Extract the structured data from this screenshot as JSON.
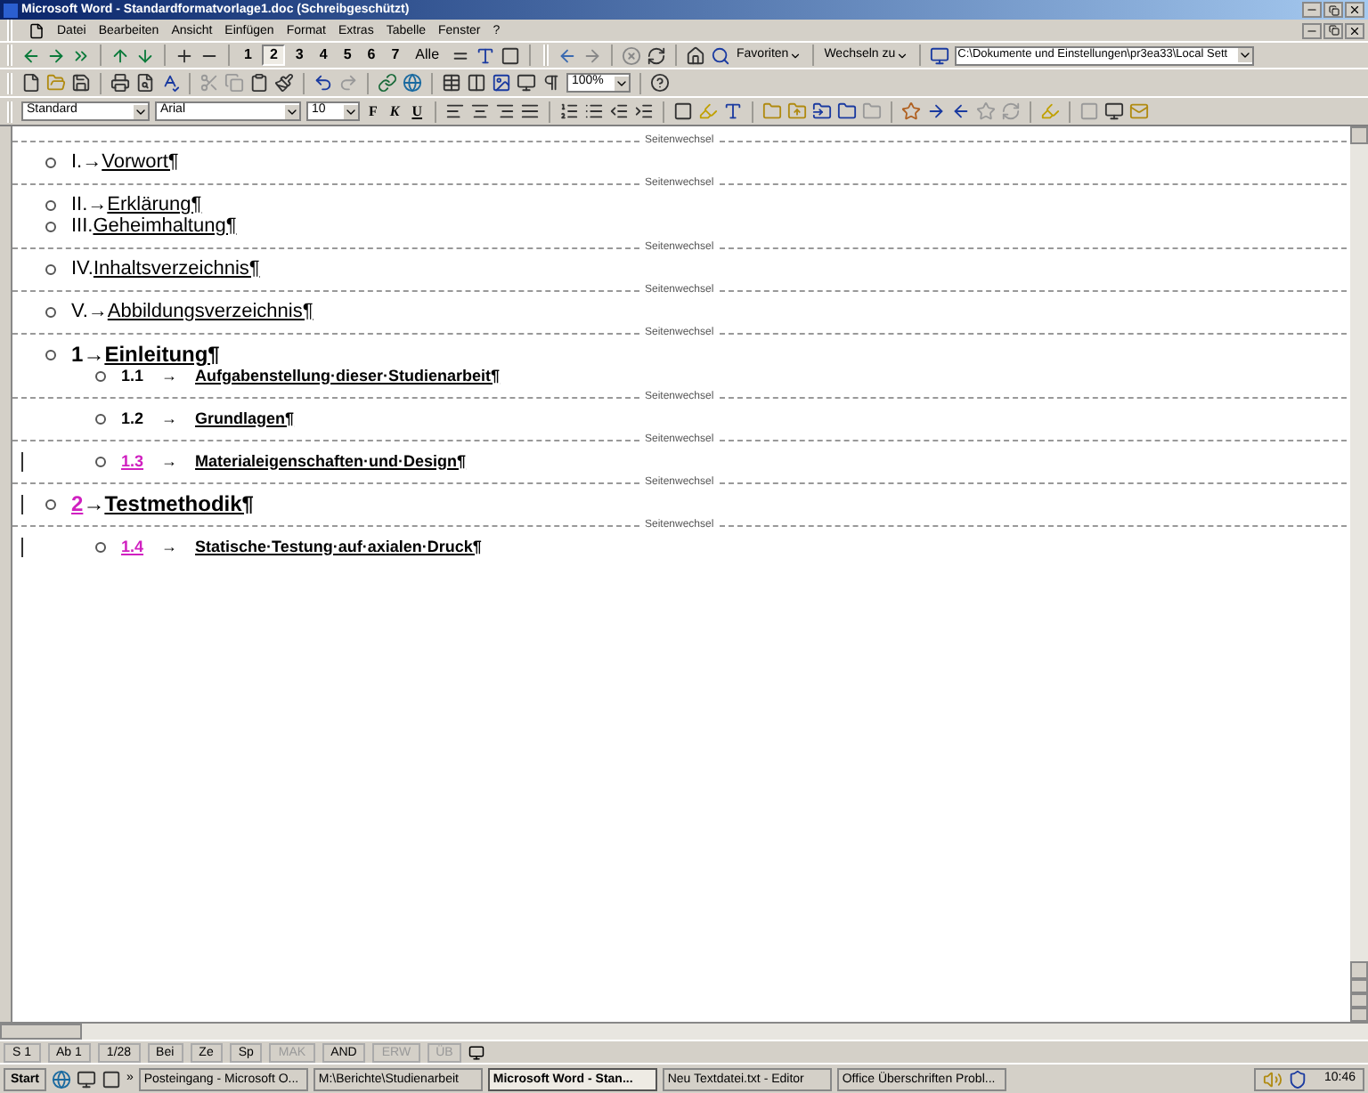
{
  "window": {
    "title": "Microsoft Word - Standardformatvorlage1.doc (Schreibgeschützt)"
  },
  "menu": [
    "Datei",
    "Bearbeiten",
    "Ansicht",
    "Einfügen",
    "Format",
    "Extras",
    "Tabelle",
    "Fenster",
    "?"
  ],
  "outline_levels": [
    {
      "label": "1",
      "selected": false
    },
    {
      "label": "2",
      "selected": true
    },
    {
      "label": "3",
      "selected": false
    },
    {
      "label": "4",
      "selected": false
    },
    {
      "label": "5",
      "selected": false
    },
    {
      "label": "6",
      "selected": false
    },
    {
      "label": "7",
      "selected": false
    },
    {
      "label": "Alle",
      "selected": false
    }
  ],
  "web_toolbar": {
    "favorites": "Favoriten",
    "switch_to": "Wechseln zu",
    "address": "C:\\Dokumente und Einstellungen\\pr3ea33\\Local Sett"
  },
  "zoom": "100%",
  "formatting": {
    "style": "Standard",
    "font": "Arial",
    "size": "10",
    "bold": "F",
    "italic": "K",
    "underline": "U"
  },
  "document": [
    {
      "kind": "page-break",
      "label": "Seitenwechsel"
    },
    {
      "kind": "heading",
      "bold": false,
      "changed": false,
      "number": "I.",
      "arrow": "→",
      "title": "Vorwort¶"
    },
    {
      "kind": "page-break",
      "label": "Seitenwechsel"
    },
    {
      "kind": "heading",
      "bold": false,
      "changed": false,
      "number": "II.",
      "arrow": "→",
      "title": "Erklärung¶"
    },
    {
      "kind": "heading",
      "bold": false,
      "changed": false,
      "number": "III.",
      "title": "Geheimhaltung¶"
    },
    {
      "kind": "page-break",
      "label": "Seitenwechsel"
    },
    {
      "kind": "heading",
      "bold": false,
      "changed": false,
      "number": "IV.",
      "title": "Inhaltsverzeichnis¶"
    },
    {
      "kind": "page-break",
      "label": "Seitenwechsel"
    },
    {
      "kind": "heading",
      "bold": false,
      "changed": false,
      "number": "V.",
      "arrow": "→",
      "title": "Abbildungsverzeichnis¶"
    },
    {
      "kind": "page-break",
      "label": "Seitenwechsel"
    },
    {
      "kind": "heading",
      "bold": true,
      "changed": false,
      "number": "1",
      "arrow": "→",
      "title": "Einleitung¶",
      "children": [
        {
          "kind": "heading",
          "bold": true,
          "changed": false,
          "number": "1.1",
          "arrow": "→",
          "title": "Aufgabenstellung·dieser·Studienarbeit¶"
        },
        {
          "kind": "page-break",
          "label": "Seitenwechsel"
        },
        {
          "kind": "heading",
          "bold": true,
          "changed": false,
          "number": "1.2",
          "arrow": "→",
          "title": "Grundlagen¶"
        },
        {
          "kind": "page-break",
          "label": "Seitenwechsel"
        },
        {
          "kind": "heading",
          "bold": true,
          "changed": true,
          "number": "1.3",
          "arrow": "→",
          "title": "Materialeigenschaften·und·Design¶"
        },
        {
          "kind": "page-break",
          "label": "Seitenwechsel"
        }
      ]
    },
    {
      "kind": "heading",
      "bold": true,
      "changed": true,
      "number": "2",
      "arrow": "→",
      "title": "Testmethodik¶",
      "children": [
        {
          "kind": "page-break",
          "label": "Seitenwechsel"
        },
        {
          "kind": "heading",
          "bold": true,
          "changed": true,
          "number": "1.4",
          "arrow": "→",
          "title": "Statische·Testung·auf·axialen·Druck¶"
        }
      ]
    }
  ],
  "status_bar": [
    {
      "text": "S 1",
      "disabled": false
    },
    {
      "text": "Ab 1",
      "disabled": false
    },
    {
      "text": "1/28",
      "disabled": false
    },
    {
      "text": "Bei",
      "disabled": false
    },
    {
      "text": "Ze",
      "disabled": false
    },
    {
      "text": "Sp",
      "disabled": false
    },
    {
      "text": "MAK",
      "disabled": true
    },
    {
      "text": "AND",
      "disabled": false
    },
    {
      "text": "ERW",
      "disabled": true
    },
    {
      "text": "ÜB",
      "disabled": true
    }
  ],
  "taskbar": {
    "start": "Start",
    "more": "»",
    "tasks": [
      {
        "label": "Posteingang - Microsoft O...",
        "selected": false
      },
      {
        "label": "M:\\Berichte\\Studienarbeit",
        "selected": false
      },
      {
        "label": "Microsoft Word - Stan...",
        "selected": true
      },
      {
        "label": "Neu Textdatei.txt - Editor",
        "selected": false
      },
      {
        "label": "Office Überschriften Probl...",
        "selected": false
      }
    ],
    "clock": "10:46"
  }
}
